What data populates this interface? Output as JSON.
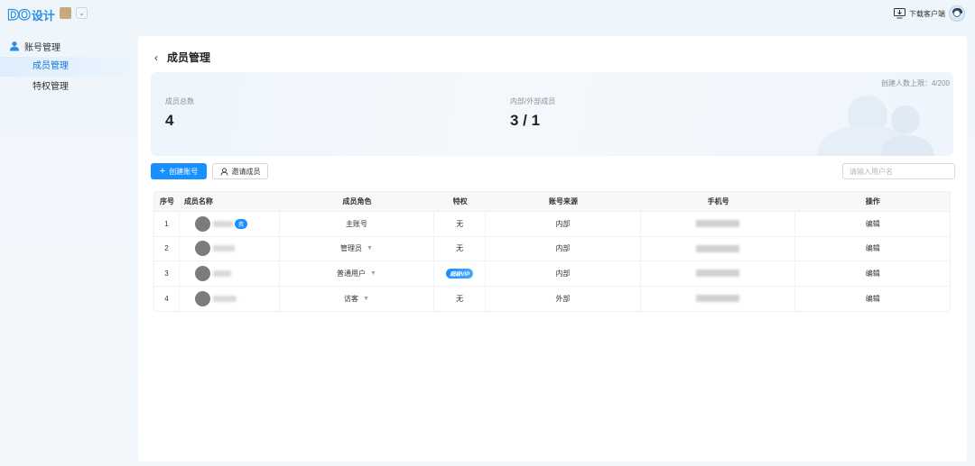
{
  "app": {
    "logo_text": "DO",
    "logo_cn": "设计",
    "download_label": "下载客户端"
  },
  "sidebar": {
    "group_label": "账号管理",
    "items": [
      {
        "label": "成员管理",
        "active": true
      },
      {
        "label": "特权管理",
        "active": false
      }
    ]
  },
  "page": {
    "title": "成员管理"
  },
  "stats": {
    "limit_caption": "创建人数上限：4/200",
    "total_label": "成员总数",
    "total_value": "4",
    "ratio_label": "内部/外部成员",
    "ratio_value": "3 / 1"
  },
  "actions": {
    "create_label": "创建账号",
    "invite_label": "邀请成员",
    "search_placeholder": "请输入用户名"
  },
  "table": {
    "headers": [
      "序号",
      "成员名称",
      "成员角色",
      "特权",
      "账号来源",
      "手机号",
      "操作"
    ],
    "rows": [
      {
        "index": "1",
        "badge": "我",
        "role": "主账号",
        "privilege": "无",
        "source": "内部",
        "action": "编辑"
      },
      {
        "index": "2",
        "badge": "",
        "role": "管理员",
        "privilege": "无",
        "source": "内部",
        "action": "编辑"
      },
      {
        "index": "3",
        "badge": "",
        "role": "普通用户",
        "privilege": "超级VIP",
        "source": "内部",
        "action": "编辑"
      },
      {
        "index": "4",
        "badge": "",
        "role": "访客",
        "privilege": "无",
        "source": "外部",
        "action": "编辑"
      }
    ]
  },
  "colors": {
    "accent": "#1890ff",
    "active_sidebar_text": "#1677d6"
  }
}
